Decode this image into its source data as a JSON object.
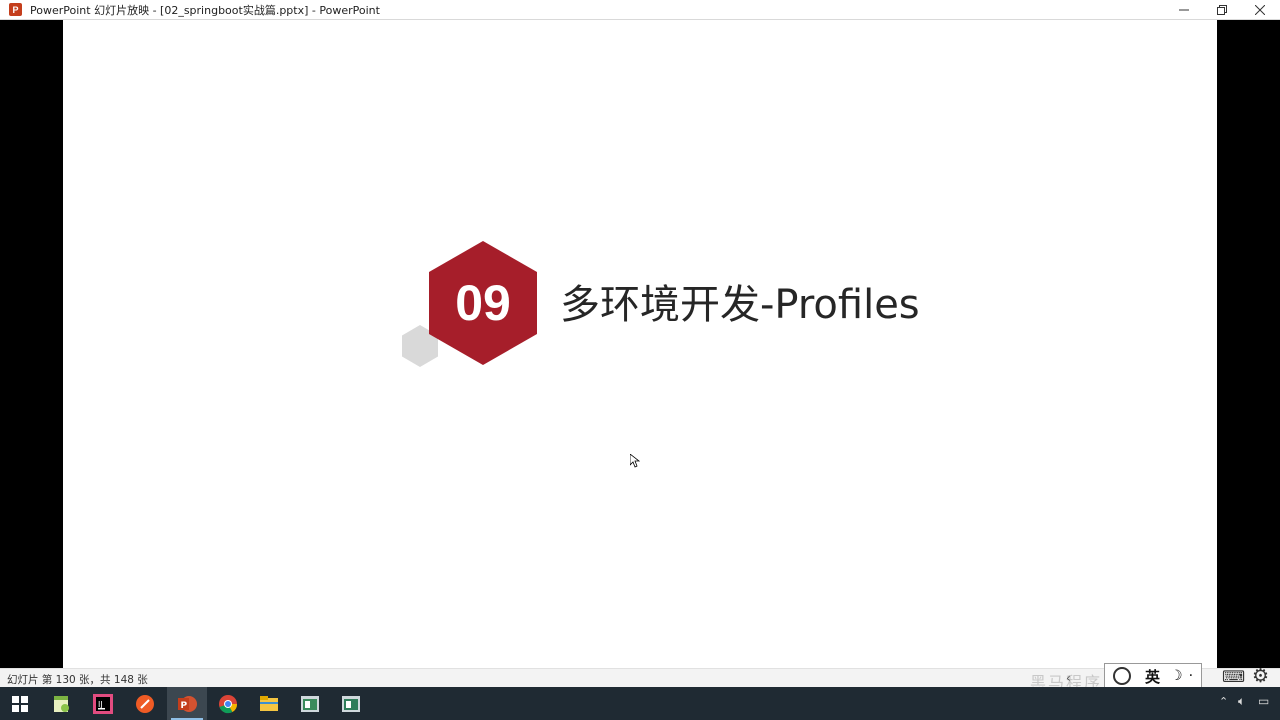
{
  "window": {
    "title": "PowerPoint 幻灯片放映 - [02_springboot实战篇.pptx] - PowerPoint",
    "app_icon_letter": "P"
  },
  "slide": {
    "number": "09",
    "title": "多环境开发-Profiles",
    "accent_color": "#a61e2a",
    "secondary_hex_color": "#d9d9d9"
  },
  "status": {
    "slide_info": "幻灯片 第 130 张，共 148 张",
    "watermark": "黑马程序员",
    "ime_language": "英"
  },
  "taskbar": {
    "items": [
      {
        "name": "windows-start-icon",
        "active": false
      },
      {
        "name": "notepad-plus-icon",
        "active": false
      },
      {
        "name": "intellij-idea-icon",
        "active": false
      },
      {
        "name": "postman-icon",
        "active": false
      },
      {
        "name": "powerpoint-icon",
        "active": true
      },
      {
        "name": "chrome-icon",
        "active": false
      },
      {
        "name": "file-explorer-icon",
        "active": false
      },
      {
        "name": "app-window-icon",
        "active": false
      },
      {
        "name": "app-window-icon-2",
        "active": false
      }
    ]
  }
}
